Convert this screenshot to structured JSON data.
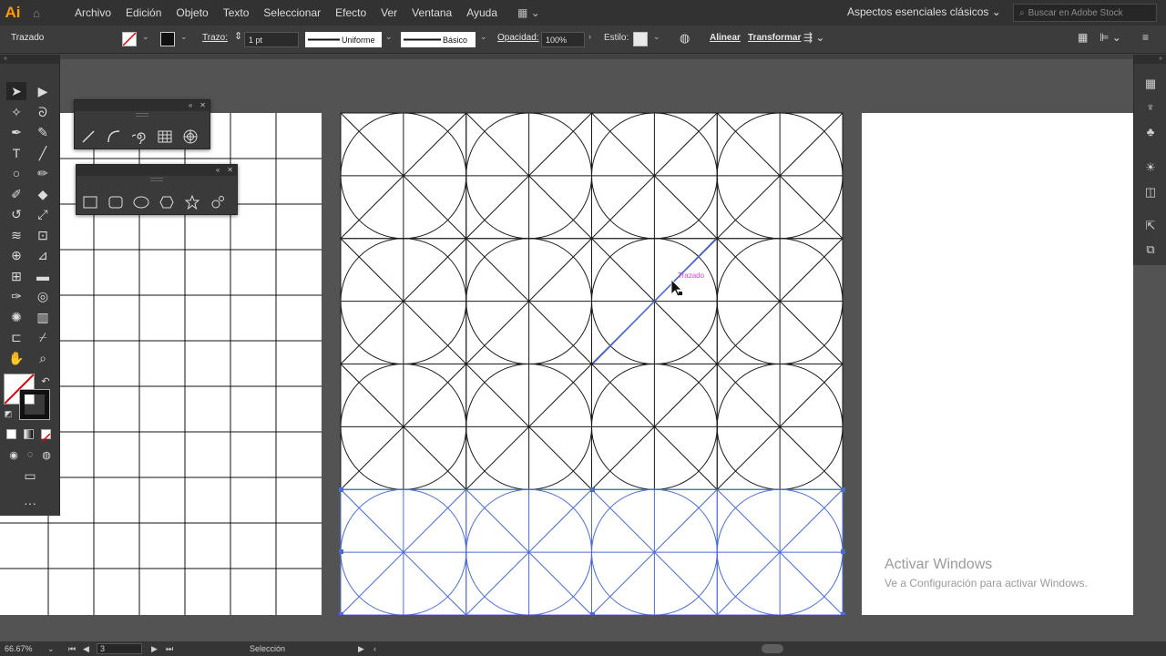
{
  "app": {
    "logo": "Ai",
    "home_icon": "home-icon"
  },
  "menu": [
    "Archivo",
    "Edición",
    "Objeto",
    "Texto",
    "Seleccionar",
    "Efecto",
    "Ver",
    "Ventana",
    "Ayuda"
  ],
  "workspace": "Aspectos esenciales clásicos",
  "search_placeholder": "Buscar en Adobe Stock",
  "control": {
    "object_type": "Trazado",
    "stroke_label": "Trazo:",
    "stroke_weight": "1 pt",
    "profile": "Uniforme",
    "brush": "Básico",
    "opacity_label": "Opacidad:",
    "opacity": "100%",
    "style_label": "Estilo:",
    "align": "Alinear",
    "transform": "Transformar"
  },
  "canvas": {
    "smart_guide_label": "Trazado",
    "selection_color": "#4a6cd4",
    "guide_color": "#e040e0"
  },
  "status": {
    "zoom": "66.67%",
    "artboard": "3",
    "tool": "Selección"
  },
  "watermark": {
    "title": "Activar Windows",
    "subtitle": "Ve a Configuración para activar Windows."
  }
}
